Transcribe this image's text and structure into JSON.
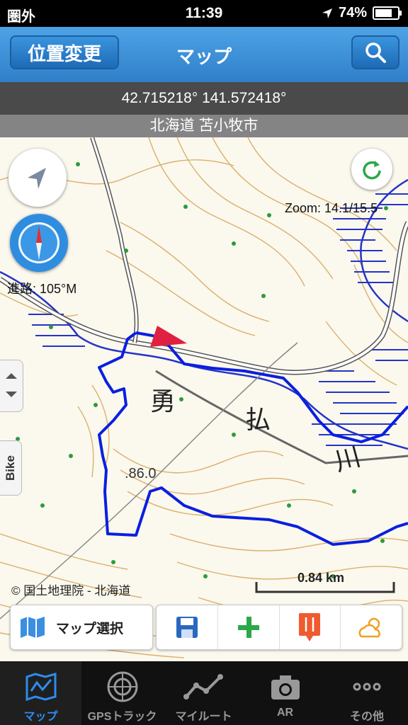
{
  "status_bar": {
    "carrier": "圏外",
    "time": "11:39",
    "battery": "74%"
  },
  "nav": {
    "left_button": "位置変更",
    "title": "マップ"
  },
  "coords": "42.715218° 141.572418°",
  "region": "北海道 苫小牧市",
  "map": {
    "zoom": "Zoom: 14.1/15.5",
    "heading": "進路: 105°M",
    "side_tab_label": "Bike",
    "place_chars": [
      "勇",
      "払",
      "川"
    ],
    "elevation": ".86.0",
    "attribution": "© 国土地理院 - 北海道",
    "scale": "0.84 km"
  },
  "toolbar": {
    "map_select": "マップ選択"
  },
  "tabs": [
    {
      "label": "マップ",
      "icon": "map-icon"
    },
    {
      "label": "GPSトラック",
      "icon": "radar-icon"
    },
    {
      "label": "マイルート",
      "icon": "route-icon"
    },
    {
      "label": "AR",
      "icon": "camera-icon"
    },
    {
      "label": "その他",
      "icon": "more-icon"
    }
  ],
  "colors": {
    "track": "#0a1fe0",
    "accent": "#2d8cf0",
    "contour": "#d9b16a",
    "marsh": "#2434c8"
  }
}
